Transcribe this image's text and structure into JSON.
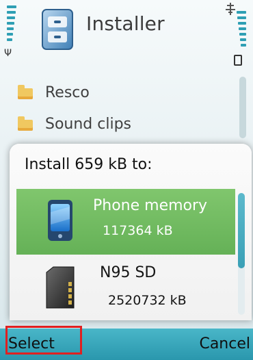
{
  "app": {
    "title": "Installer",
    "icon": "installer-cabinet-icon"
  },
  "status": {
    "signal_icon": "antenna-icon",
    "battery_icon": "battery-icon",
    "network_icon": "network-transfer-icon"
  },
  "background_list": {
    "items": [
      {
        "label": "Resco",
        "icon": "folder-icon"
      },
      {
        "label": "Sound clips",
        "icon": "folder-icon"
      }
    ]
  },
  "dialog": {
    "title": "Install 659 kB to:",
    "options": [
      {
        "name": "Phone memory",
        "size": "117364 kB",
        "icon": "phone-memory-icon",
        "selected": true
      },
      {
        "name": "N95 SD",
        "size": "2520732 kB",
        "icon": "memory-card-icon",
        "selected": false
      }
    ]
  },
  "softkeys": {
    "left": "Select",
    "right": "Cancel"
  },
  "colors": {
    "selection": "#6cb85a",
    "accent": "#2f9fb4",
    "softkey_bar": "#3aa7bc",
    "highlight_box": "#e02020"
  }
}
